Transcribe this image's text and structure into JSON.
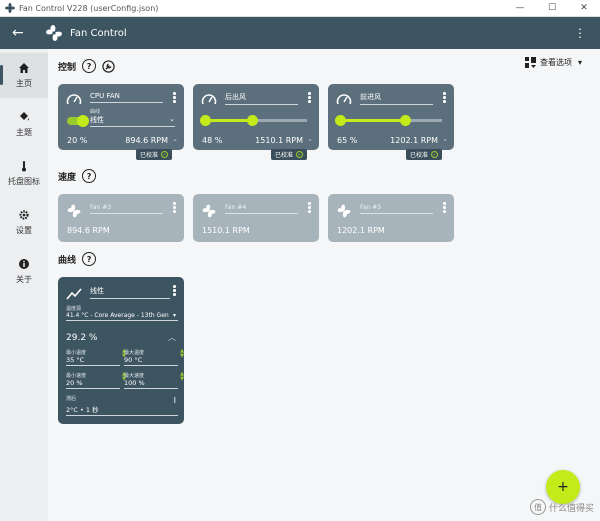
{
  "window": {
    "title": "Fan Control V228 (userConfig.json)",
    "min": "—",
    "max": "☐",
    "close": "✕"
  },
  "appbar": {
    "title": "Fan Control",
    "more": "⋮"
  },
  "sidebar": {
    "items": [
      {
        "label": "主页",
        "icon": "home-icon"
      },
      {
        "label": "主题",
        "icon": "paint-bucket-icon"
      },
      {
        "label": "托盘图标",
        "icon": "thermometer-icon"
      },
      {
        "label": "设置",
        "icon": "gear-icon"
      },
      {
        "label": "关于",
        "icon": "info-icon"
      }
    ]
  },
  "sections": {
    "controls": "控制",
    "speeds": "速度",
    "curves": "曲线",
    "help": "?"
  },
  "sort": {
    "label": "查看选项",
    "arrow": "▾"
  },
  "controls": [
    {
      "name": "CPU FAN",
      "curve_label": "曲线",
      "curve": "线性",
      "percent": "20 %",
      "rpm": "894.6 RPM",
      "badge": "已校准",
      "level": 0.2
    },
    {
      "name": "后出风",
      "percent": "48 %",
      "rpm": "1510.1 RPM",
      "badge": "已校准",
      "level": 0.48
    },
    {
      "name": "前进风",
      "percent": "65 %",
      "rpm": "1202.1 RPM",
      "badge": "已校准",
      "level": 0.65
    }
  ],
  "speeds": [
    {
      "name": "Fan #3",
      "rpm": "894.6 RPM"
    },
    {
      "name": "Fan #4",
      "rpm": "1510.1 RPM"
    },
    {
      "name": "Fan #5",
      "rpm": "1202.1 RPM"
    }
  ],
  "curve": {
    "name": "线性",
    "temp_label": "温度源",
    "temp": "41.4 °C - Core Average - 13th Gen",
    "current": "29.2 %",
    "min_temp_label": "最小温度",
    "min_temp": "35 °C",
    "max_temp_label": "最大温度",
    "max_temp": "90 °C",
    "min_speed_label": "最小速度",
    "min_speed": "20 %",
    "max_speed_label": "最大速度",
    "max_speed": "100 %",
    "step_label": "滞后",
    "step": "2°C • 1 秒"
  },
  "fab": "+",
  "watermark": "什么值得买",
  "watermark_mark": "值"
}
